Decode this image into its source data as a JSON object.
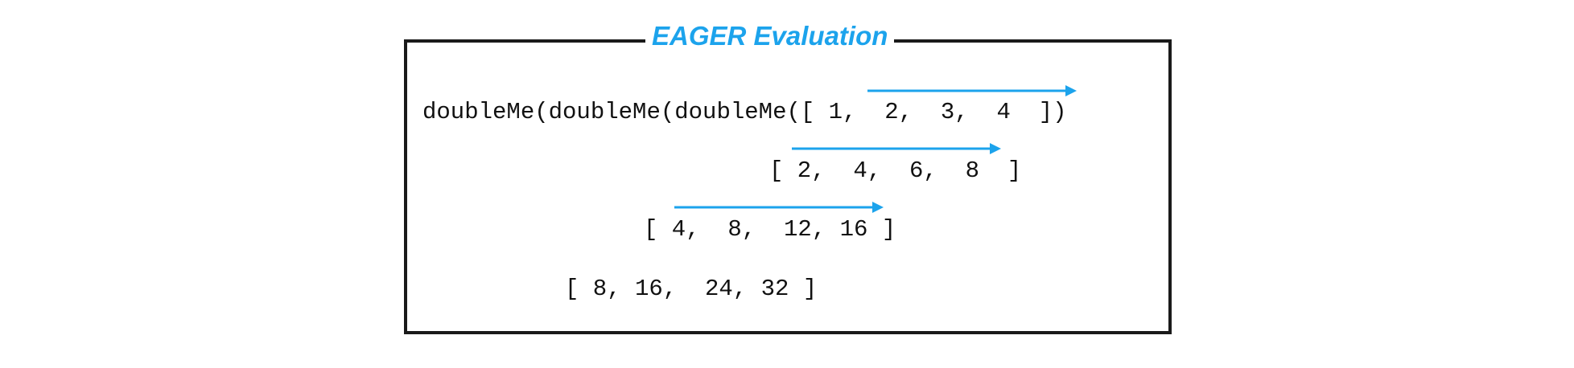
{
  "title": "EAGER Evaluation",
  "colors": {
    "accent": "#1ca3ec",
    "frame": "#1a1a1a",
    "text": "#111111"
  },
  "lines": [
    "doubleMe(doubleMe(doubleMe([ 1,  2,  3,  4  ])",
    "[ 2,  4,  6,  8  ]",
    "[ 4,  8,  12, 16 ]",
    "[ 8, 16,  24, 32 ]"
  ]
}
